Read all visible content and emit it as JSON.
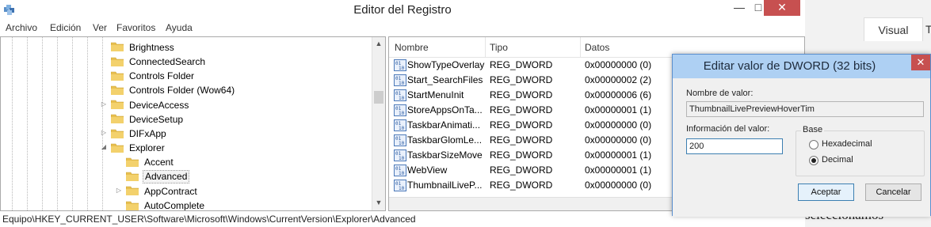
{
  "window": {
    "title": "Editor del Registro",
    "minimize": "—",
    "maximize": "□",
    "close": "✕"
  },
  "menu": [
    "Archivo",
    "Edición",
    "Ver",
    "Favoritos",
    "Ayuda"
  ],
  "tree": {
    "items": [
      {
        "label": "Brightness",
        "expander": "",
        "level": 0
      },
      {
        "label": "ConnectedSearch",
        "expander": "",
        "level": 0
      },
      {
        "label": "Controls Folder",
        "expander": "",
        "level": 0
      },
      {
        "label": "Controls Folder (Wow64)",
        "expander": "",
        "level": 0
      },
      {
        "label": "DeviceAccess",
        "expander": "▷",
        "level": 0
      },
      {
        "label": "DeviceSetup",
        "expander": "",
        "level": 0
      },
      {
        "label": "DIFxApp",
        "expander": "▷",
        "level": 0
      },
      {
        "label": "Explorer",
        "expander": "◢",
        "level": 0
      },
      {
        "label": "Accent",
        "expander": "",
        "level": 1
      },
      {
        "label": "Advanced",
        "expander": "",
        "level": 1,
        "selected": true
      },
      {
        "label": "AppContract",
        "expander": "▷",
        "level": 1
      },
      {
        "label": "AutoComplete",
        "expander": "",
        "level": 1
      }
    ]
  },
  "list": {
    "headers": [
      "Nombre",
      "Tipo",
      "Datos"
    ],
    "rows": [
      {
        "name": "ShowTypeOverlay",
        "type": "REG_DWORD",
        "data": "0x00000000 (0)"
      },
      {
        "name": "Start_SearchFiles",
        "type": "REG_DWORD",
        "data": "0x00000002 (2)"
      },
      {
        "name": "StartMenuInit",
        "type": "REG_DWORD",
        "data": "0x00000006 (6)"
      },
      {
        "name": "StoreAppsOnTa...",
        "type": "REG_DWORD",
        "data": "0x00000001 (1)"
      },
      {
        "name": "TaskbarAnimati...",
        "type": "REG_DWORD",
        "data": "0x00000000 (0)"
      },
      {
        "name": "TaskbarGlomLe...",
        "type": "REG_DWORD",
        "data": "0x00000000 (0)"
      },
      {
        "name": "TaskbarSizeMove",
        "type": "REG_DWORD",
        "data": "0x00000001 (1)"
      },
      {
        "name": "WebView",
        "type": "REG_DWORD",
        "data": "0x00000001 (1)"
      },
      {
        "name": "ThumbnailLiveP...",
        "type": "REG_DWORD",
        "data": "0x00000000 (0)"
      }
    ]
  },
  "status": "Equipo\\HKEY_CURRENT_USER\\Software\\Microsoft\\Windows\\CurrentVersion\\Explorer\\Advanced",
  "side": {
    "tab_active": "Visual",
    "tab_next": "T",
    "body_text": "seleccionamos"
  },
  "dialog": {
    "title": "Editar valor de DWORD (32 bits)",
    "close": "✕",
    "value_name_label": "Nombre de valor:",
    "value_name": "ThumbnailLivePreviewHoverTim",
    "value_data_label": "Información del valor:",
    "value_data": "200",
    "base_label": "Base",
    "radio_hex": "Hexadecimal",
    "radio_dec": "Decimal",
    "base_selected": "Decimal",
    "ok": "Aceptar",
    "cancel": "Cancelar"
  },
  "colors": {
    "dialog_title_bg": "#aed0f3",
    "close_button": "#c75050",
    "folder": "#e8c050"
  }
}
